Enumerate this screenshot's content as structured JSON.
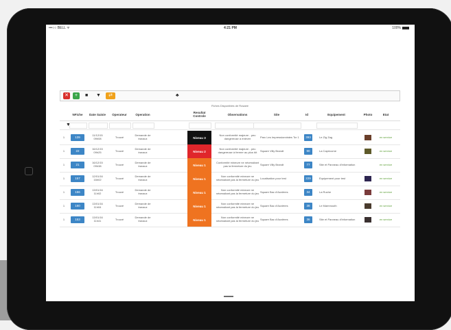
{
  "status_bar": {
    "carrier": "•••○○ BELL ᯤ",
    "time": "4:21 PM",
    "battery": "100%"
  },
  "toolbar": {
    "buttons": [
      {
        "name": "delete",
        "icon": "✕",
        "color": "#d9302c"
      },
      {
        "name": "add",
        "icon": "+",
        "color": "#3aa54a"
      },
      {
        "name": "trash",
        "icon": "■",
        "color": "#222222"
      },
      {
        "name": "filter",
        "icon": "▼",
        "color": "#222222"
      },
      {
        "name": "export",
        "icon": "⇄",
        "color": "#f0a21c"
      }
    ],
    "extra_icon": "♣"
  },
  "table": {
    "title": "Fiches Disponibles de Rosaire",
    "headers": [
      "",
      "NFiche",
      "Date Saisie",
      "Operateur",
      "Operation",
      "Resultat Controle",
      "Observations",
      "Site",
      "Id",
      "Equipement",
      "Photo",
      "Etat"
    ],
    "filter_icon": "▼",
    "rows": [
      {
        "num": "1",
        "nfiche": "139",
        "date": "11/12/15\n09h08",
        "operateur": "Trouvé",
        "operation": "Demande de travaux",
        "level": "Niveau 3",
        "level_color": "#111111",
        "obs": "Non conformité majeure - peu dangereuse à enlever",
        "site": "Parc Les Impressionnistes Tcr 1",
        "id": "393",
        "equip": "Le Zig Zag",
        "photo_color": "#6a3f2a",
        "etat": "en service"
      },
      {
        "num": "1",
        "nfiche": "22",
        "date": "16/12/15\n09h25",
        "operateur": "Trouvé",
        "operation": "Demande de travaux",
        "level": "Niveau 2",
        "level_color": "#e0262b",
        "obs": "Non conformité majeure - peu dangereuse à fermer au plus tôt",
        "site": "Square Villy Brandt",
        "id": "90",
        "equip": "La Capricorne",
        "photo_color": "#5e5a2a",
        "etat": "en service"
      },
      {
        "num": "1",
        "nfiche": "21",
        "date": "16/12/15\n09h38",
        "operateur": "Trouvé",
        "operation": "Demande de travaux",
        "level": "Niveau 1",
        "level_color": "#ef7320",
        "obs": "Conformité mineure ne nécessitant pas la fermeture du jeu",
        "site": "Square Villy Brandt",
        "id": "77",
        "equip": "Site et Panneau d'information",
        "photo_color": "#ffffff",
        "etat": "en service"
      },
      {
        "num": "1",
        "nfiche": "157",
        "date": "12/01/16\n16h02",
        "operateur": "Trouvé",
        "operation": "Demande de travaux",
        "level": "Niveau 1",
        "level_color": "#ef7320",
        "obs": "Non conformité mineure ne nécessitant pas la fermeture du jeu",
        "site": "Localisation pour test",
        "id": "229",
        "equip": "Equipement pour test",
        "photo_color": "#2d2550",
        "etat": "en service"
      },
      {
        "num": "1",
        "nfiche": "156",
        "date": "13/01/16\n11h02",
        "operateur": "Trouvé",
        "operation": "Demande de travaux",
        "level": "Niveau 1",
        "level_color": "#ef7320",
        "obs": "Non conformité mineure ne nécessitant pas la fermeture du jeu",
        "site": "Square Bac d'Asnières",
        "id": "34",
        "equip": "La Ruche",
        "photo_color": "#7a3b3b",
        "etat": "en service"
      },
      {
        "num": "1",
        "nfiche": "160",
        "date": "13/01/16\n11h04",
        "operateur": "Trouvé",
        "operation": "Demande de travaux",
        "level": "Niveau 1",
        "level_color": "#ef7320",
        "obs": "Non conformité mineure ne nécessitant pas la fermeture du jeu",
        "site": "Square Bac d'Asnières",
        "id": "38",
        "equip": "Le Mammouth",
        "photo_color": "#4a3b2e",
        "etat": "en service"
      },
      {
        "num": "1",
        "nfiche": "153",
        "date": "13/01/16\n11h41",
        "operateur": "Trouvé",
        "operation": "Demande de travaux",
        "level": "Niveau 1",
        "level_color": "#ef7320",
        "obs": "Non conformité mineure ne nécessitant pas la fermeture du jeu",
        "site": "Square Bac d'Asnières",
        "id": "36",
        "equip": "Site et Panneau d'information",
        "photo_color": "#3a3030",
        "etat": "en service"
      }
    ]
  }
}
